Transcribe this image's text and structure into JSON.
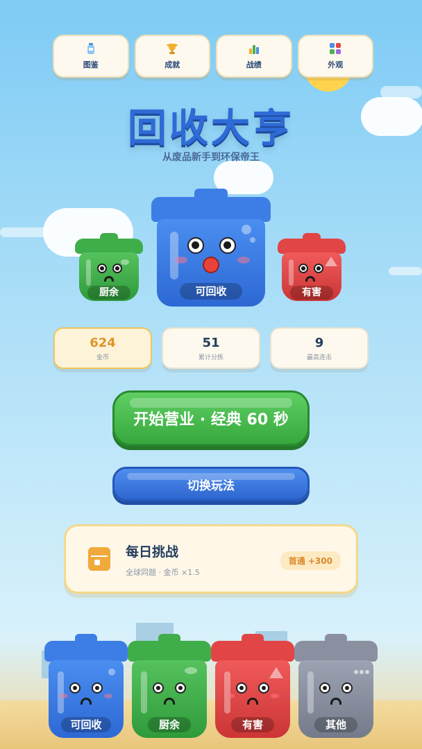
{
  "nav": {
    "items": [
      {
        "label": "图鉴",
        "icon": "bottle-icon"
      },
      {
        "label": "成就",
        "icon": "trophy-icon"
      },
      {
        "label": "战绩",
        "icon": "bar-chart-icon"
      },
      {
        "label": "外观",
        "icon": "grid-icon"
      }
    ]
  },
  "header": {
    "title": "回收大亨",
    "subtitle": "从废品新手到环保帝王"
  },
  "hero_bins": {
    "left": "厨余",
    "center": "可回收",
    "right": "有害"
  },
  "stats": [
    {
      "value": "624",
      "caption": "金币"
    },
    {
      "value": "51",
      "caption": "累计分拣"
    },
    {
      "value": "9",
      "caption": "最高连击"
    }
  ],
  "actions": {
    "start_label": "开始营业 · 经典 60 秒",
    "switch_label": "切换玩法"
  },
  "daily": {
    "title": "每日挑战",
    "description": "全球同题 · 金币 ×1.5",
    "badge": "首通 +300"
  },
  "bottom_bins": {
    "recyclable": "可回收",
    "kitchen": "厨余",
    "hazardous": "有害",
    "other": "其他"
  },
  "colors": {
    "blue": "#3d7ee6",
    "green": "#3fae4a",
    "red": "#e24545",
    "gray": "#8a90a0",
    "gold": "#e0952a"
  }
}
